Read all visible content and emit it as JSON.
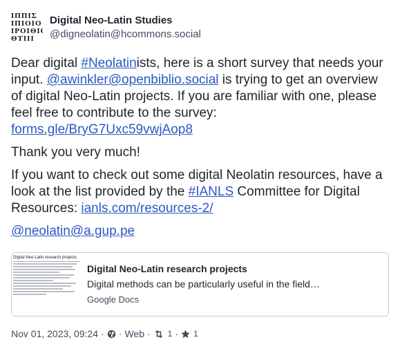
{
  "author": {
    "avatar_rows": [
      "IΠΠΙΣ",
      "IΠIOIO",
      "IPOIΘIO",
      "ΘTIII"
    ],
    "display_name": "Digital Neo-Latin Studies",
    "handle": "@digneolatin@hcommons.social"
  },
  "content": {
    "p1_a": "Dear digital ",
    "p1_hashtag": "#Neolatin",
    "p1_b": "ists, here is a short survey that needs your input. ",
    "p1_mention": "@awinkler@openbiblio.social",
    "p1_c": " is trying to get an overview of digital Neo-Latin projects. If you are familiar with one, please feel free to contribute to the survey:",
    "p1_link": "forms.gle/BryG7Uxc59vwjAop8",
    "p2": "Thank you very much!",
    "p3_a": "If you want to check out some digital Neolatin resources, have a look at the list provided by the ",
    "p3_hashtag": "#IANLS",
    "p3_b": " Committee for Digital Resources: ",
    "p3_link": "ianls.com/resources-2/",
    "p4_mention": "@neolatin@a.gup.pe"
  },
  "card": {
    "thumb_title": "Digital Neo-Latin research projects",
    "title": "Digital Neo-Latin research projects",
    "description": "Digital methods can be particularly useful in the field…",
    "provider": "Google Docs"
  },
  "meta": {
    "timestamp": "Nov 01, 2023, 09:24",
    "sep1": "·",
    "globe_icon": "globe-icon",
    "sep2": "·",
    "application": "Web",
    "sep3": "·",
    "boost_icon": "boost-icon",
    "boost_count": "1",
    "sep4": "·",
    "star_icon": "star-icon",
    "favourite_count": "1"
  }
}
